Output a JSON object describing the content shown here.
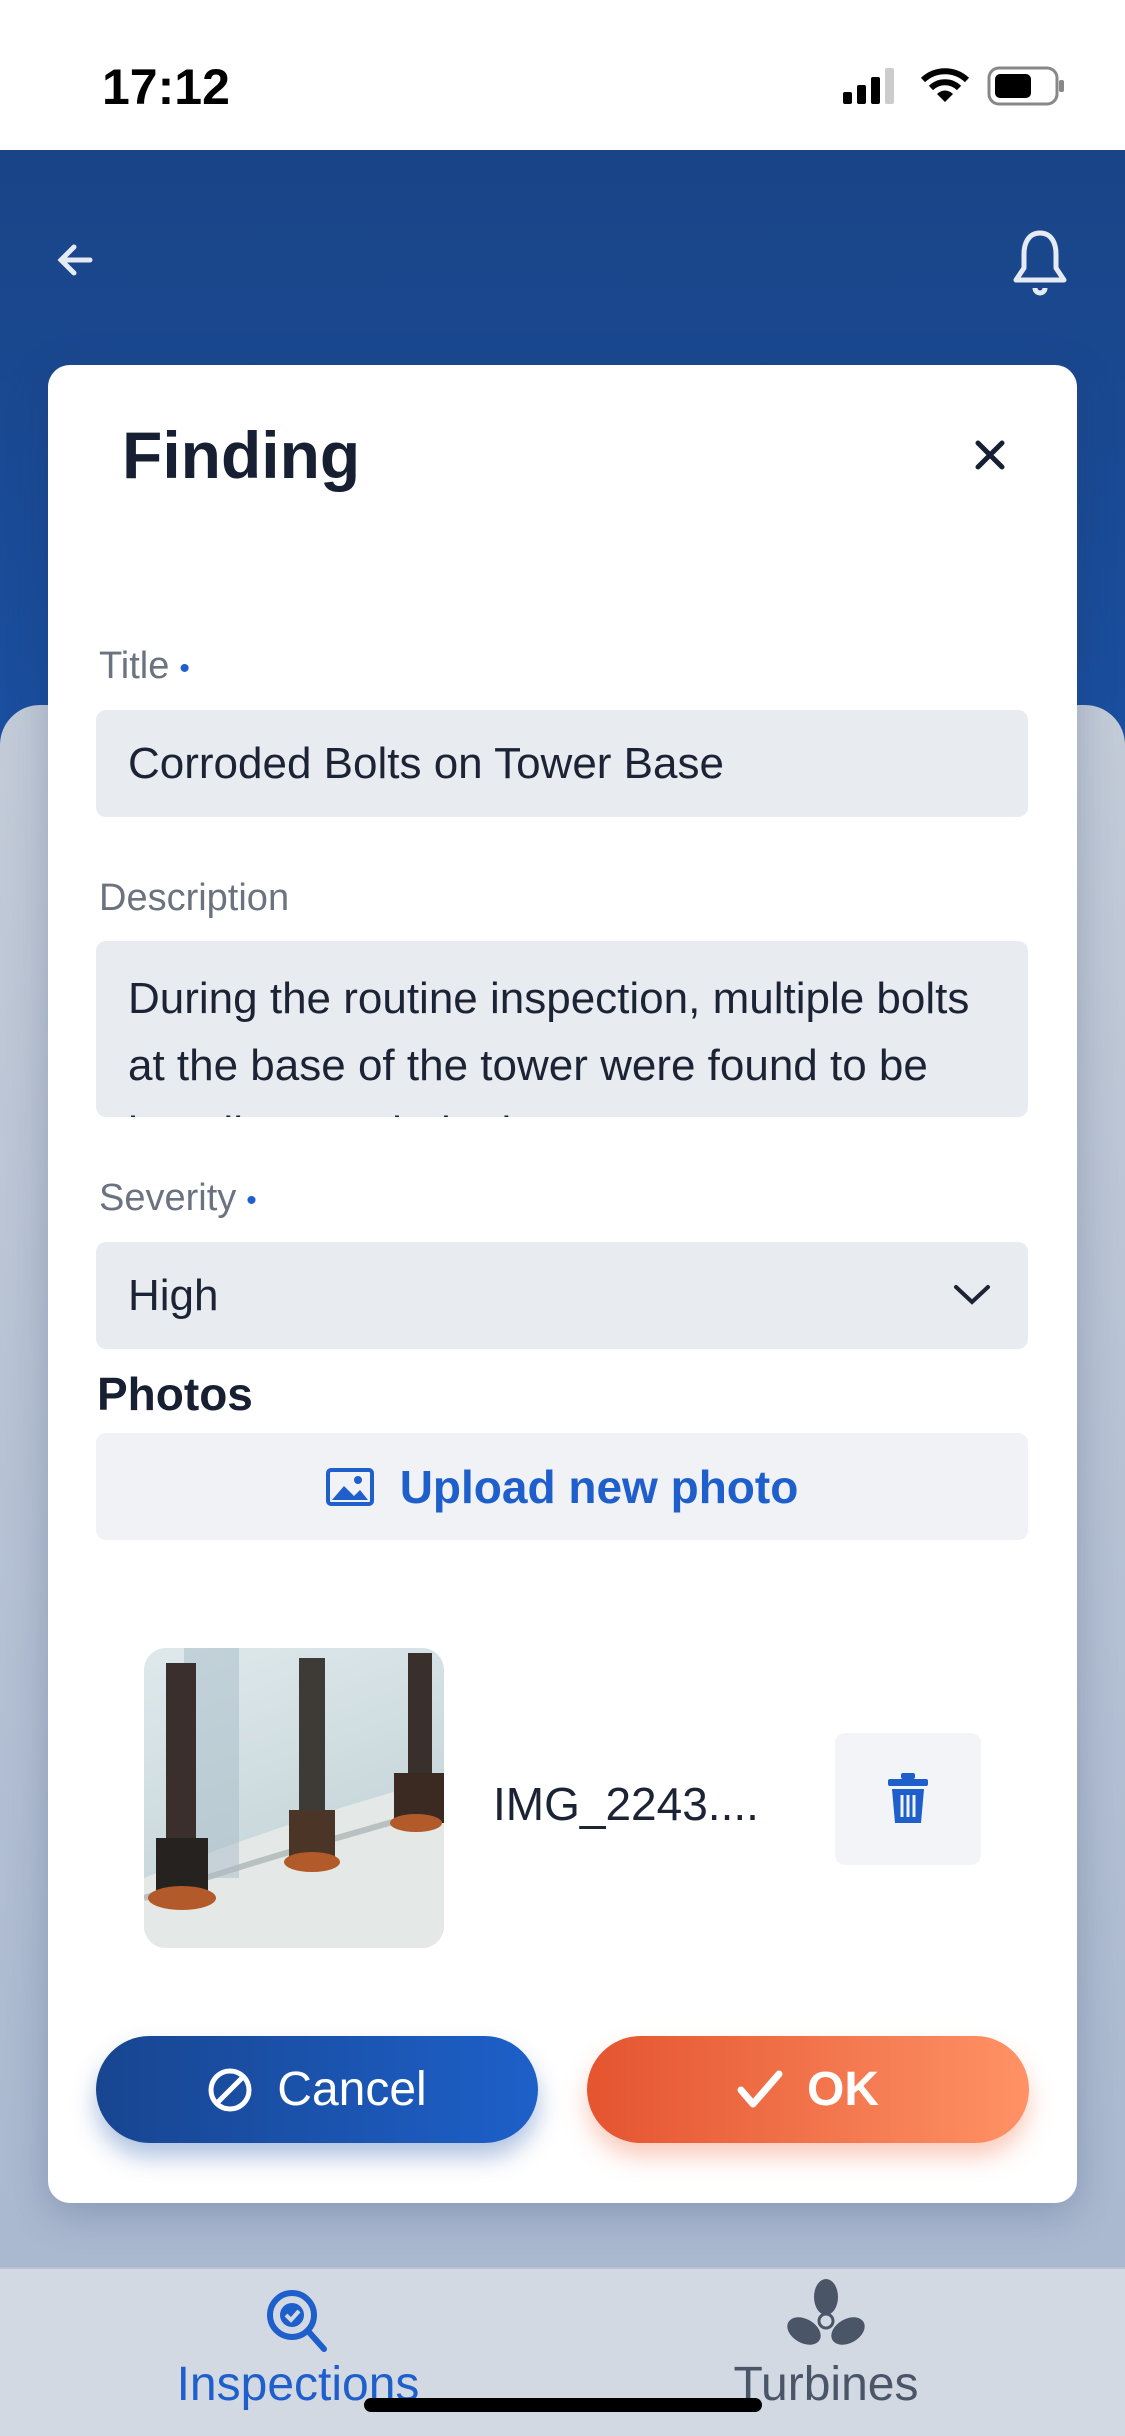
{
  "status_bar": {
    "time": "17:12"
  },
  "header": {
    "back_icon": "arrow-left-icon",
    "bell_icon": "bell-icon"
  },
  "modal": {
    "title": "Finding",
    "fields": {
      "title": {
        "label": "Title",
        "required": true,
        "value": "Corroded Bolts on Tower Base"
      },
      "description": {
        "label": "Description",
        "value": "During the routine inspection, multiple bolts at the base of the tower were found to be heavily corroded. The"
      },
      "severity": {
        "label": "Severity",
        "required": true,
        "value": "High"
      }
    },
    "photos": {
      "heading": "Photos",
      "upload_label": "Upload new photo",
      "items": [
        {
          "filename": "IMG_2243...."
        }
      ]
    },
    "cancel_label": "Cancel",
    "ok_label": "OK"
  },
  "tabbar": {
    "items": [
      {
        "label": "Inspections",
        "active": true
      },
      {
        "label": "Turbines",
        "active": false
      }
    ]
  },
  "colors": {
    "primary": "#1a4487",
    "accent": "#1f5fcc",
    "ok": "#e4542f"
  }
}
